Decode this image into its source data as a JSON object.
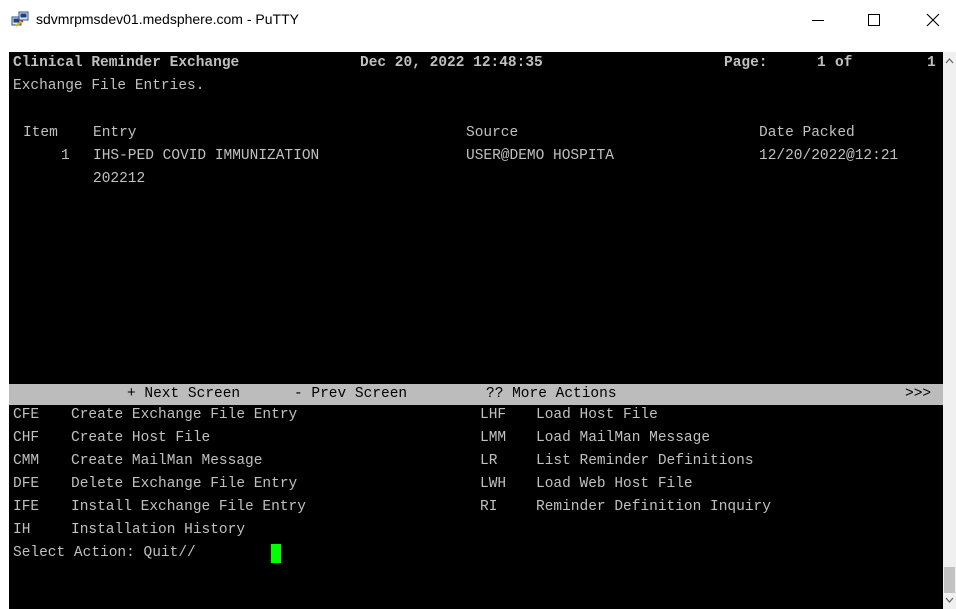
{
  "window": {
    "title": "sdvmrpmsdev01.medsphere.com - PuTTY",
    "icon": "putty-icon"
  },
  "window_controls": [
    "minimize-icon",
    "maximize-icon",
    "close-icon"
  ],
  "terminal": {
    "header": {
      "title": "Clinical Reminder Exchange",
      "datetime": "Dec 20, 2022 12:48:35",
      "page_label": "Page:",
      "page_current": "1",
      "page_of": "of",
      "page_total": "1"
    },
    "subtitle": "Exchange File Entries.",
    "columns": {
      "item": "Item",
      "entry": "Entry",
      "source": "Source",
      "date_packed": "Date Packed"
    },
    "entries": [
      {
        "item": "1",
        "entry": "IHS-PED COVID IMMUNIZATION",
        "entry_cont": "202212",
        "source": "USER@DEMO HOSPITA",
        "date_packed": "12/20/2022@12:21"
      }
    ],
    "action_bar": {
      "next": "+ Next Screen",
      "prev": "- Prev Screen",
      "more": "?? More Actions",
      "more_arrow": ">>>"
    },
    "actions_left": [
      {
        "code": "CFE",
        "label": "Create Exchange File Entry"
      },
      {
        "code": "CHF",
        "label": "Create Host File"
      },
      {
        "code": "CMM",
        "label": "Create MailMan Message"
      },
      {
        "code": "DFE",
        "label": "Delete Exchange File Entry"
      },
      {
        "code": "IFE",
        "label": "Install Exchange File Entry"
      },
      {
        "code": "IH",
        "label": "Installation History"
      }
    ],
    "actions_right": [
      {
        "code": "LHF",
        "label": "Load Host File"
      },
      {
        "code": "LMM",
        "label": "Load MailMan Message"
      },
      {
        "code": "LR",
        "label": "List Reminder Definitions"
      },
      {
        "code": "LWH",
        "label": "Load Web Host File"
      },
      {
        "code": "RI",
        "label": "Reminder Definition Inquiry"
      }
    ],
    "prompt": "Select Action: Quit//",
    "colors": {
      "background": "#000000",
      "text": "#c0c0c0",
      "action_bar": "#bcbcbc",
      "cursor": "#00ff00"
    }
  }
}
